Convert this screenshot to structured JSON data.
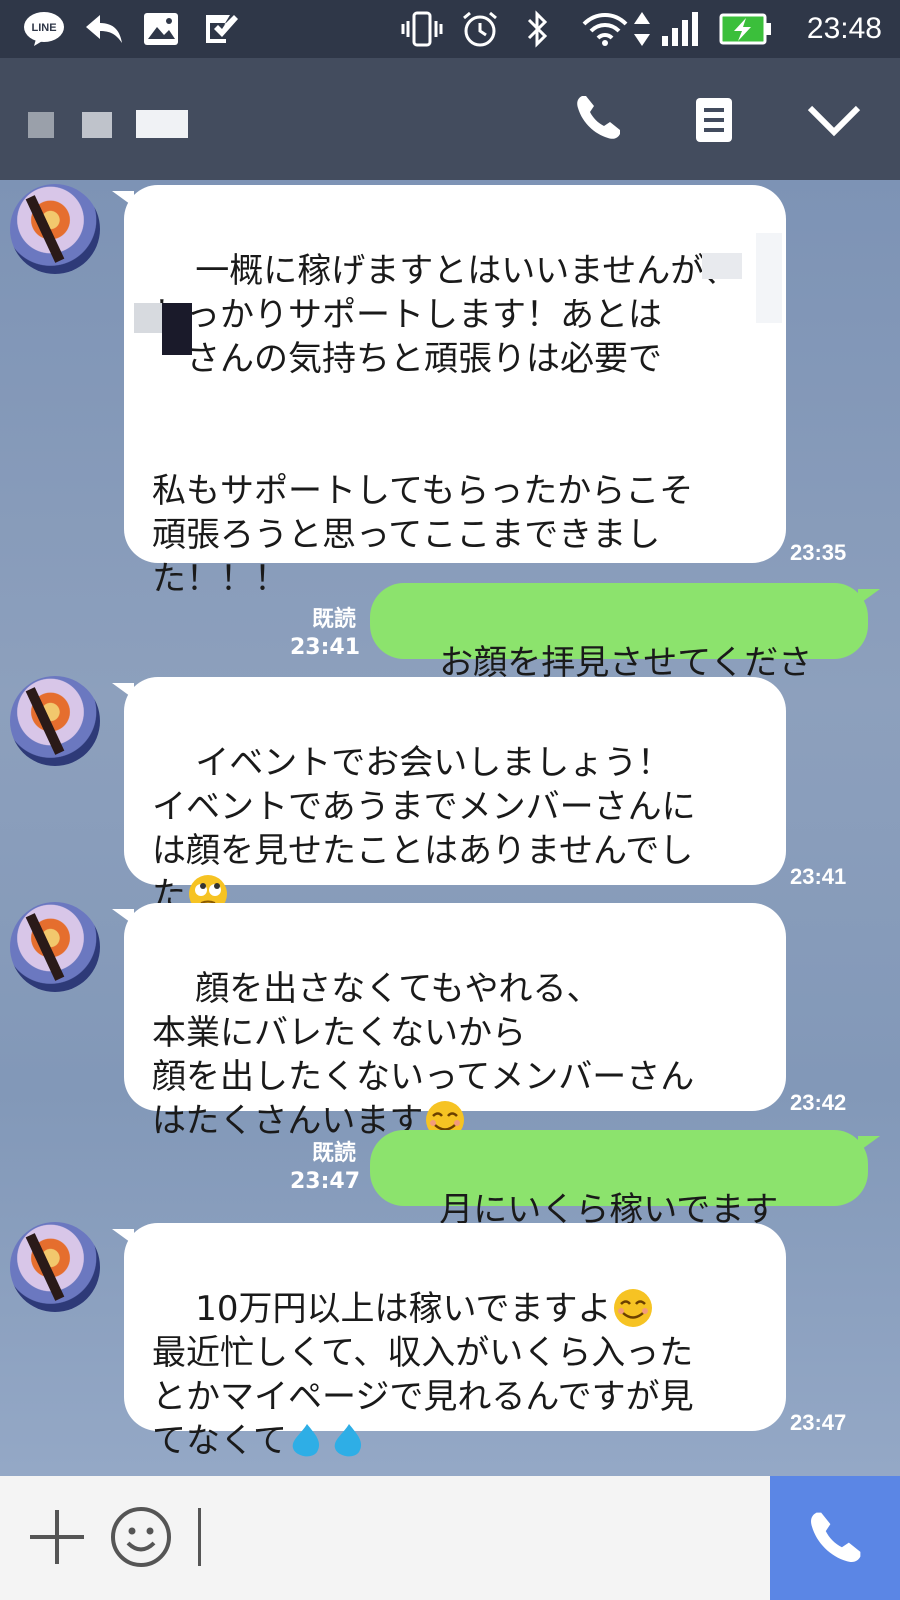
{
  "statusbar": {
    "time": "23:48",
    "line_badge": "LINE"
  },
  "header": {
    "title": ""
  },
  "messages": [
    {
      "id": "m1",
      "side": "in",
      "time": "23:35",
      "text": "一概に稼げますとはいいませんが、\nしっかりサポートします！あとは\n　さんの気持ちと頑張りは必要で\n\n\n私もサポートしてもらったからこそ\n頑張ろうと思ってここまできまし\nた！！！"
    },
    {
      "id": "m2",
      "side": "out",
      "read": "既読",
      "time": "23:41",
      "text": "お顔を拝見させてください"
    },
    {
      "id": "m3",
      "side": "in",
      "time": "23:41",
      "text": "イベントでお会いしましょう！\nイベントであうまでメンバーさんに\nは顔を見せたことはありませんでし\nた",
      "emoji": "eye-roll-emoji"
    },
    {
      "id": "m4",
      "side": "in",
      "time": "23:42",
      "text": "顔を出さなくてもやれる、\n本業にバレたくないから\n顔を出したくないってメンバーさん\nはたくさんいます",
      "emoji": "smile-emoji"
    },
    {
      "id": "m5",
      "side": "out",
      "read": "既読",
      "time": "23:47",
      "text": "月にいくら稼いでますか？"
    },
    {
      "id": "m6",
      "side": "in",
      "time": "23:47",
      "line1": "10万円以上は稼いでますよ",
      "text": "最近忙しくて、収入がいくら入った\nとかマイページで見れるんですが見\nてなくて",
      "emoji": "smile-emoji",
      "emoji2": "sweat-drops-emoji"
    }
  ],
  "colors": {
    "bubble_out": "#8ce36d",
    "bubble_in": "#ffffff",
    "call_button": "#5b86e5",
    "header": "#434c5e"
  }
}
